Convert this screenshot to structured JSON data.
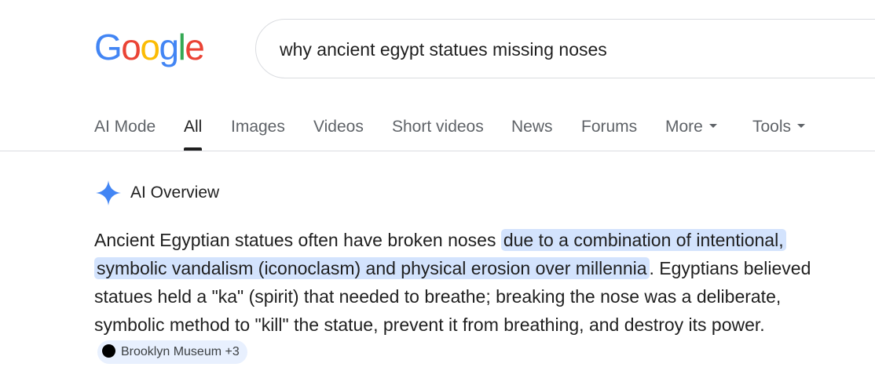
{
  "logo": {
    "letters": [
      {
        "char": "G",
        "color": "#4285F4"
      },
      {
        "char": "o",
        "color": "#EA4335"
      },
      {
        "char": "o",
        "color": "#FBBC05"
      },
      {
        "char": "g",
        "color": "#4285F4"
      },
      {
        "char": "l",
        "color": "#34A853"
      },
      {
        "char": "e",
        "color": "#EA4335"
      }
    ]
  },
  "search": {
    "query": "why ancient egypt statues missing noses"
  },
  "tabs": [
    {
      "label": "AI Mode"
    },
    {
      "label": "All",
      "active": true
    },
    {
      "label": "Images"
    },
    {
      "label": "Videos"
    },
    {
      "label": "Short videos"
    },
    {
      "label": "News"
    },
    {
      "label": "Forums"
    },
    {
      "label": "More",
      "dropdown": true
    },
    {
      "label": "Tools",
      "dropdown": true
    }
  ],
  "ai_overview": {
    "title": "AI Overview",
    "icon": "sparkle-icon",
    "text_before": "Ancient Egyptian statues often have broken noses ",
    "text_highlight": "due to a combination of intentional, symbolic vandalism (iconoclasm) and physical erosion over millennia",
    "text_after": ". Egyptians believed statues held a \"ka\" (spirit) that needed to breathe; breaking the nose was a deliberate, symbolic method to \"kill\" the statue, prevent it from breathing, and destroy its power.",
    "source_chip": "Brooklyn Museum +3"
  },
  "colors": {
    "highlight": "#d3e3fd",
    "chip_bg": "#e8f0fe",
    "sparkle": "#4285F4",
    "active_tab": "#1f1f1f",
    "inactive_tab": "#5f6368"
  }
}
